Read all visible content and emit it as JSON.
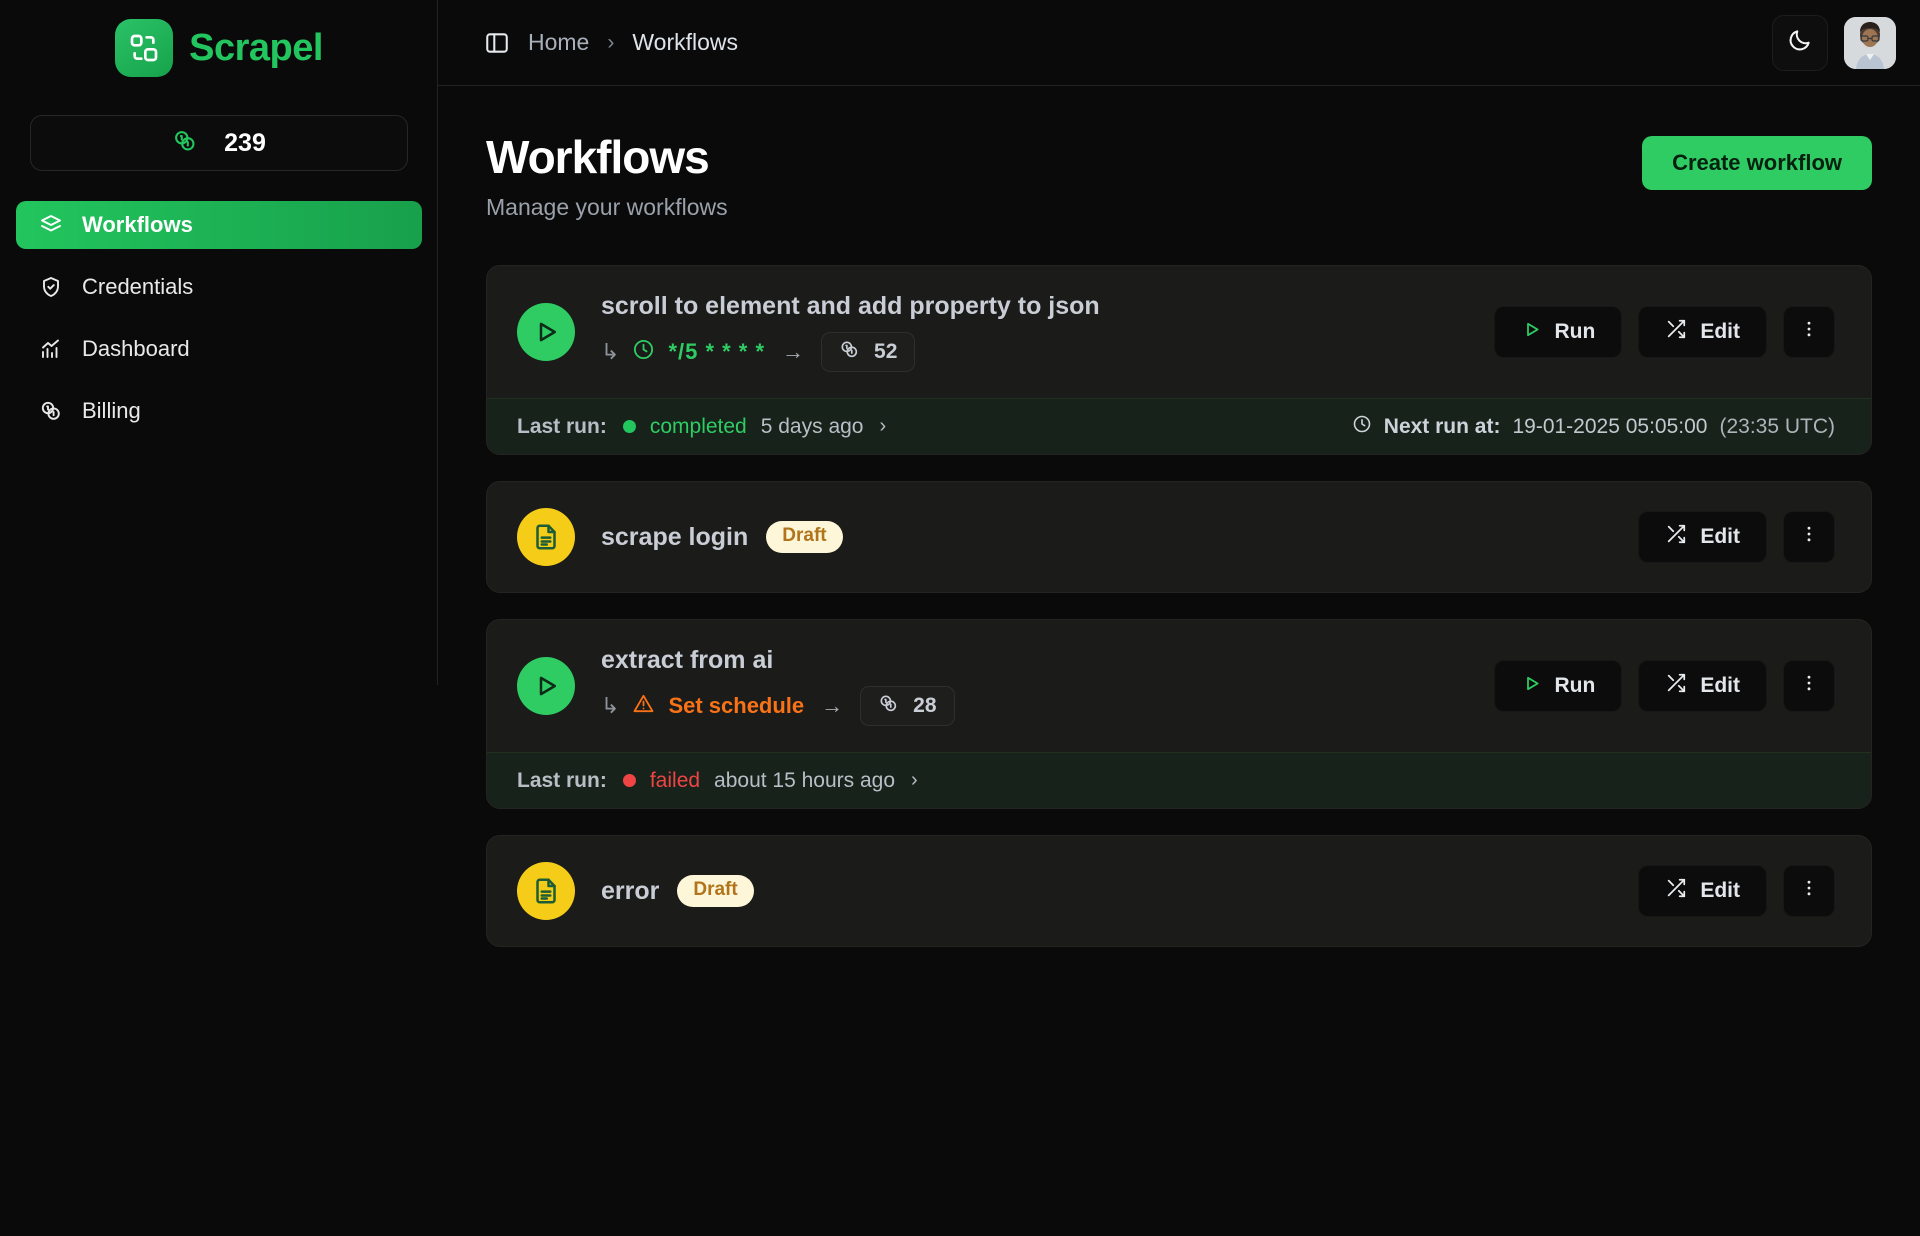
{
  "brand": {
    "name": "Scrapel",
    "logo_icon": "scrapel-logo-icon",
    "accent": "#22c55e"
  },
  "sidebar": {
    "credits": {
      "icon": "coins-icon",
      "value": "239"
    },
    "items": [
      {
        "label": "Workflows",
        "icon": "layers-icon",
        "active": true
      },
      {
        "label": "Credentials",
        "icon": "shield-check-icon",
        "active": false
      },
      {
        "label": "Dashboard",
        "icon": "chart-bar-icon",
        "active": false
      },
      {
        "label": "Billing",
        "icon": "coins-icon",
        "active": false
      }
    ]
  },
  "topbar": {
    "panel_toggle_icon": "panel-left-icon",
    "breadcrumbs": [
      "Home",
      "Workflows"
    ],
    "separator": "›",
    "theme_toggle_icon": "moon-icon",
    "avatar_icon": "user-avatar"
  },
  "page": {
    "title": "Workflows",
    "subtitle": "Manage your workflows",
    "create_button": "Create workflow"
  },
  "labels": {
    "run": "Run",
    "edit": "Edit",
    "more": "more-options",
    "last_run": "Last run:",
    "next_run": "Next run at:",
    "chevron": "›",
    "arrow_right": "→",
    "corner_arrow": "↳",
    "draft": "Draft"
  },
  "colors": {
    "green": "#2ecc63",
    "yellow": "#f5cd19",
    "orange": "#f97316",
    "red": "#ef4444",
    "draft_pill_bg": "#fdf6d8",
    "draft_pill_text": "#b1741a"
  },
  "workflows": [
    {
      "name": "scroll to element and add property to json",
      "state": "published",
      "avatar_icon": "play-circle-icon",
      "schedule": {
        "icon": "clock-icon",
        "text": "*/5 * * * *",
        "kind": "cron"
      },
      "credits": {
        "icon": "coins-icon",
        "value": "52"
      },
      "actions": [
        "Run",
        "Edit"
      ],
      "last_run": {
        "status": "completed",
        "time": "5 days ago"
      },
      "next_run": {
        "datetime": "19-01-2025 05:05:00",
        "utc": "(23:35 UTC)"
      }
    },
    {
      "name": "scrape login",
      "state": "draft",
      "avatar_icon": "file-text-icon",
      "badge": "Draft",
      "actions": [
        "Edit"
      ]
    },
    {
      "name": "extract from ai",
      "state": "published",
      "avatar_icon": "play-circle-icon",
      "schedule": {
        "icon": "warning-triangle-icon",
        "text": "Set schedule",
        "kind": "unset"
      },
      "credits": {
        "icon": "coins-icon",
        "value": "28"
      },
      "actions": [
        "Run",
        "Edit"
      ],
      "last_run": {
        "status": "failed",
        "time": "about 15 hours ago"
      }
    },
    {
      "name": "error",
      "state": "draft",
      "avatar_icon": "file-text-icon",
      "badge": "Draft",
      "actions": [
        "Edit"
      ]
    }
  ]
}
